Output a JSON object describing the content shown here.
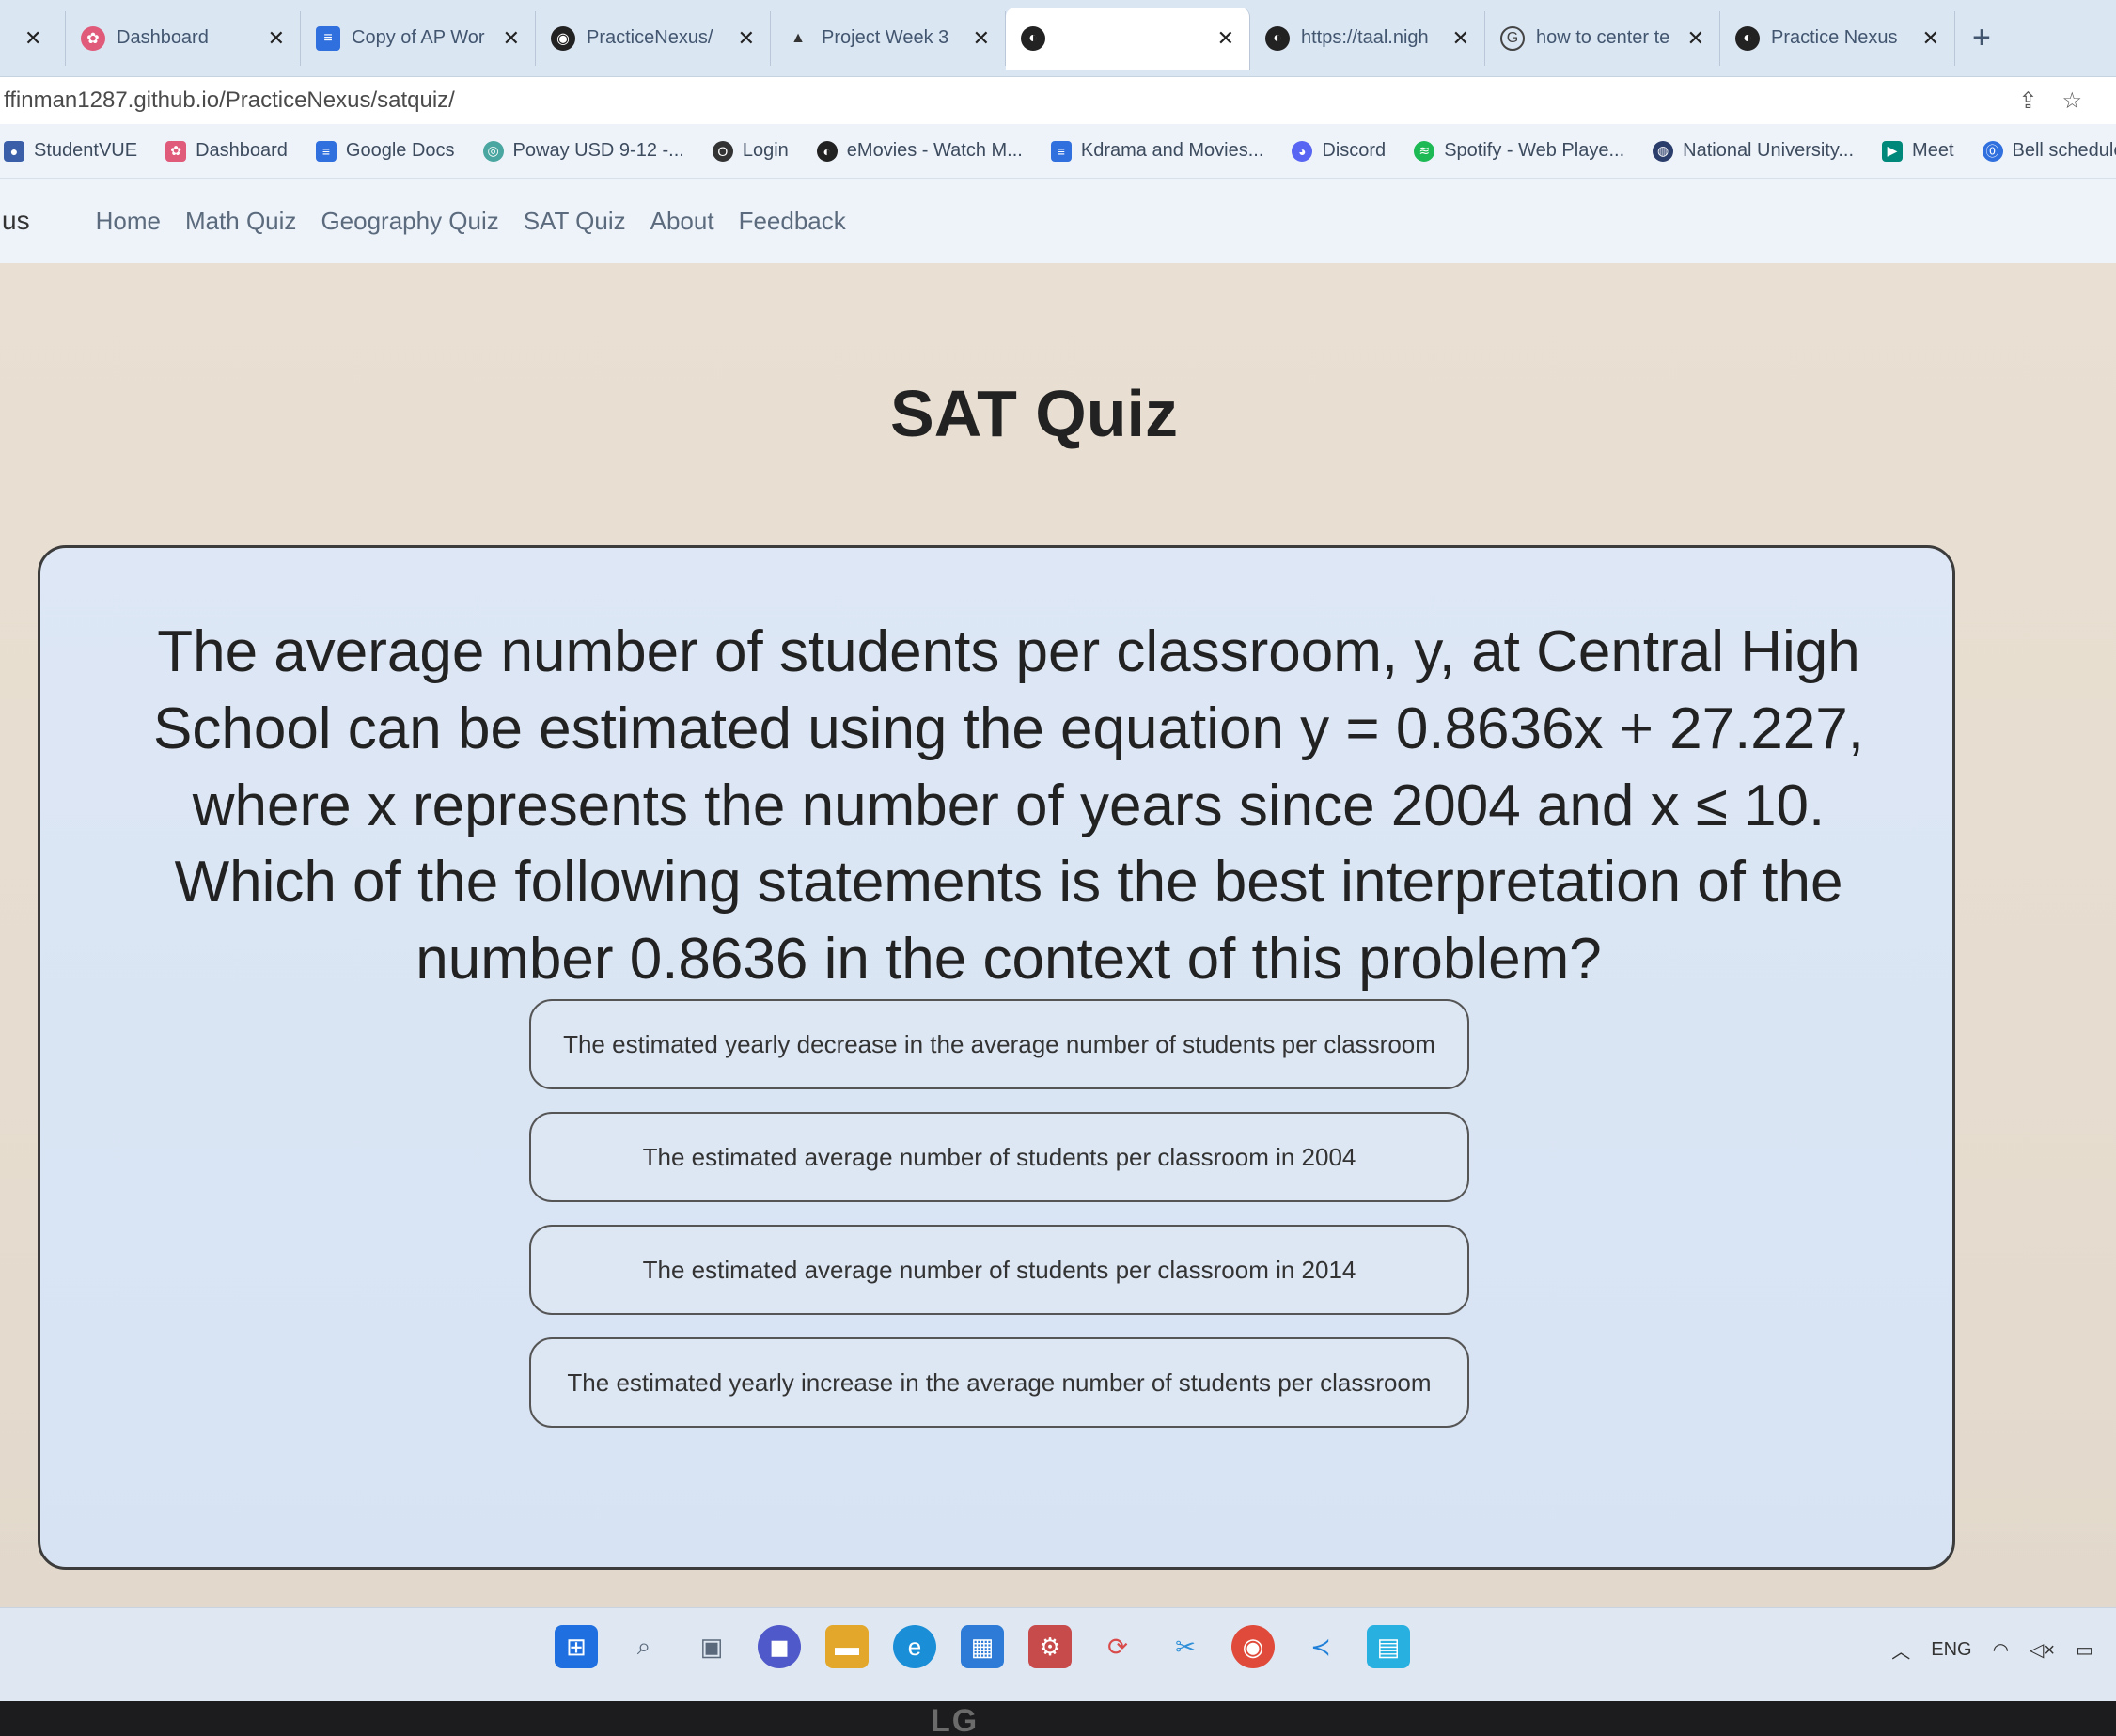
{
  "tabs": [
    {
      "label": "",
      "icon": "generic-icon",
      "color": "#8aa0bb"
    },
    {
      "label": "Dashboard",
      "icon": "dashboard-icon",
      "color": "#e05a7a"
    },
    {
      "label": "Copy of AP Wor",
      "icon": "docs-icon",
      "color": "#2f6fde"
    },
    {
      "label": "PracticeNexus/",
      "icon": "github-icon",
      "color": "#222222"
    },
    {
      "label": "Project Week 3",
      "icon": "project-icon",
      "color": "#333333"
    },
    {
      "label": "",
      "icon": "globe-icon",
      "color": "#222222",
      "active": true
    },
    {
      "label": "https://taal.nigh",
      "icon": "globe-icon",
      "color": "#222222"
    },
    {
      "label": "how to center te",
      "icon": "google-icon",
      "color": "#444444"
    },
    {
      "label": "Practice Nexus",
      "icon": "globe-icon",
      "color": "#222222"
    }
  ],
  "new_tab_label": "+",
  "address": {
    "url": "ffinman1287.github.io/PracticeNexus/satquiz/"
  },
  "bookmarks": [
    {
      "label": "StudentVUE",
      "color": "#3a5ea8"
    },
    {
      "label": "Dashboard",
      "color": "#e05a7a"
    },
    {
      "label": "Google Docs",
      "color": "#2f6fde"
    },
    {
      "label": "Poway USD 9-12 -...",
      "color": "#4aa6a0"
    },
    {
      "label": "Login",
      "color": "#333333"
    },
    {
      "label": "eMovies - Watch M...",
      "color": "#222222"
    },
    {
      "label": "Kdrama and Movies...",
      "color": "#2f6fde"
    },
    {
      "label": "Discord",
      "color": "#5865f2"
    },
    {
      "label": "Spotify - Web Playe...",
      "color": "#1db954"
    },
    {
      "label": "National University...",
      "color": "#2a3d6b"
    },
    {
      "label": "Meet",
      "color": "#00897b"
    },
    {
      "label": "Bell schedule",
      "color": "#2f6fde"
    }
  ],
  "nav": {
    "brand": "us",
    "links": [
      "Home",
      "Math Quiz",
      "Geography Quiz",
      "SAT Quiz",
      "About",
      "Feedback"
    ]
  },
  "page": {
    "title": "SAT Quiz",
    "question": "The average number of students per classroom, y, at Central High School can be estimated using the equation y = 0.8636x + 27.227, where x represents the number of years since 2004 and x ≤ 10. Which of the following statements is the best interpretation of the number 0.8636 in the context of this problem?",
    "answers": [
      "The estimated yearly decrease in the average number of students per classroom",
      "The estimated average number of students per classroom in 2004",
      "The estimated average number of students per classroom in 2014",
      "The estimated yearly increase in the average number of students per classroom"
    ]
  },
  "taskbar": {
    "apps": [
      {
        "name": "start-icon",
        "color": "#1f6fe0"
      },
      {
        "name": "search-icon",
        "color": "#5a6a7c"
      },
      {
        "name": "task-view-icon",
        "color": "#5a6a7c"
      },
      {
        "name": "chat-icon",
        "color": "#5059c9"
      },
      {
        "name": "file-explorer-icon",
        "color": "#e3a82b"
      },
      {
        "name": "edge-icon",
        "color": "#1a8fd8"
      },
      {
        "name": "store-icon",
        "color": "#2d7bd6"
      },
      {
        "name": "settings-app-icon",
        "color": "#c84b4b"
      },
      {
        "name": "sync-icon",
        "color": "#d94a4a"
      },
      {
        "name": "snipping-icon",
        "color": "#2f8fd8"
      },
      {
        "name": "chrome-icon",
        "color": "#e04a3a"
      },
      {
        "name": "vscode-icon",
        "color": "#1f7fd8"
      },
      {
        "name": "notepad-icon",
        "color": "#28b0e0"
      }
    ],
    "tray_lang": "ENG"
  },
  "bezel_logo": "LG"
}
